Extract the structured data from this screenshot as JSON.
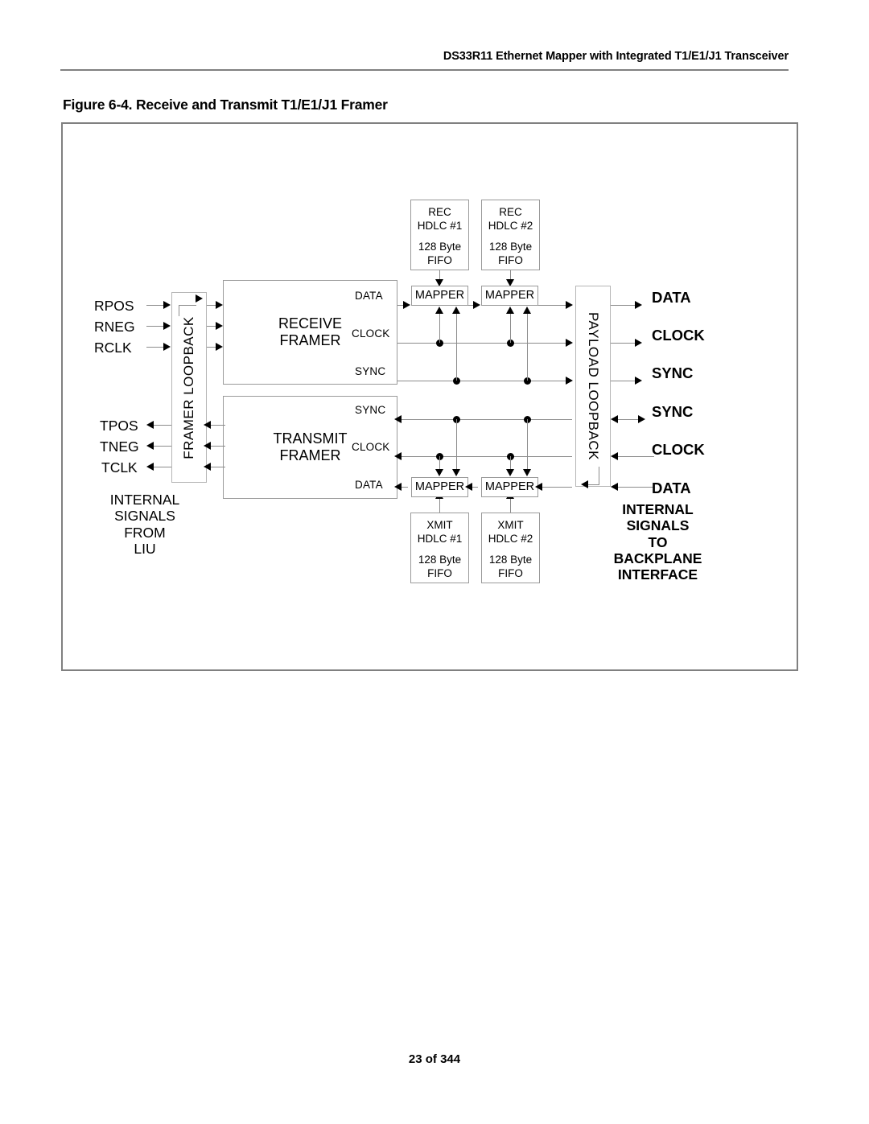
{
  "header": {
    "running_title": "DS33R11 Ethernet Mapper with Integrated T1/E1/J1 Transceiver"
  },
  "figure": {
    "title": "Figure 6-4. Receive and Transmit T1/E1/J1 Framer"
  },
  "diagram": {
    "left_inputs": [
      {
        "name": "RPOS"
      },
      {
        "name": "RNEG"
      },
      {
        "name": "RCLK"
      }
    ],
    "left_outputs": [
      {
        "name": "TPOS"
      },
      {
        "name": "TNEG"
      },
      {
        "name": "TCLK"
      }
    ],
    "left_caption": [
      "INTERNAL",
      "SIGNALS",
      "FROM",
      "LIU"
    ],
    "right_caption": [
      "INTERNAL",
      "SIGNALS",
      "TO",
      "BACKPLANE",
      "INTERFACE"
    ],
    "framer_loopback": "FRAMER LOOPBACK",
    "payload_loopback": "PAYLOAD LOOPBACK",
    "receive_framer": [
      "RECEIVE",
      "FRAMER"
    ],
    "transmit_framer": [
      "TRANSMIT",
      "FRAMER"
    ],
    "receive_ports": [
      "DATA",
      "CLOCK",
      "SYNC"
    ],
    "transmit_ports": [
      "SYNC",
      "CLOCK",
      "DATA"
    ],
    "right_outputs": [
      "DATA",
      "CLOCK",
      "SYNC"
    ],
    "right_inputs": [
      "SYNC",
      "CLOCK",
      "DATA"
    ],
    "mappers": [
      {
        "label": "MAPPER"
      },
      {
        "label": "MAPPER"
      },
      {
        "label": "MAPPER"
      },
      {
        "label": "MAPPER"
      }
    ],
    "rec_hdlc": [
      {
        "title": "REC",
        "channel": "HDLC #1",
        "size": "128 Byte",
        "kind": "FIFO"
      },
      {
        "title": "REC",
        "channel": "HDLC #2",
        "size": "128 Byte",
        "kind": "FIFO"
      }
    ],
    "xmit_hdlc": [
      {
        "title": "XMIT",
        "channel": "HDLC #1",
        "size": "128 Byte",
        "kind": "FIFO"
      },
      {
        "title": "XMIT",
        "channel": "HDLC #2",
        "size": "128 Byte",
        "kind": "FIFO"
      }
    ]
  },
  "footer": {
    "page": "23 of 344"
  }
}
